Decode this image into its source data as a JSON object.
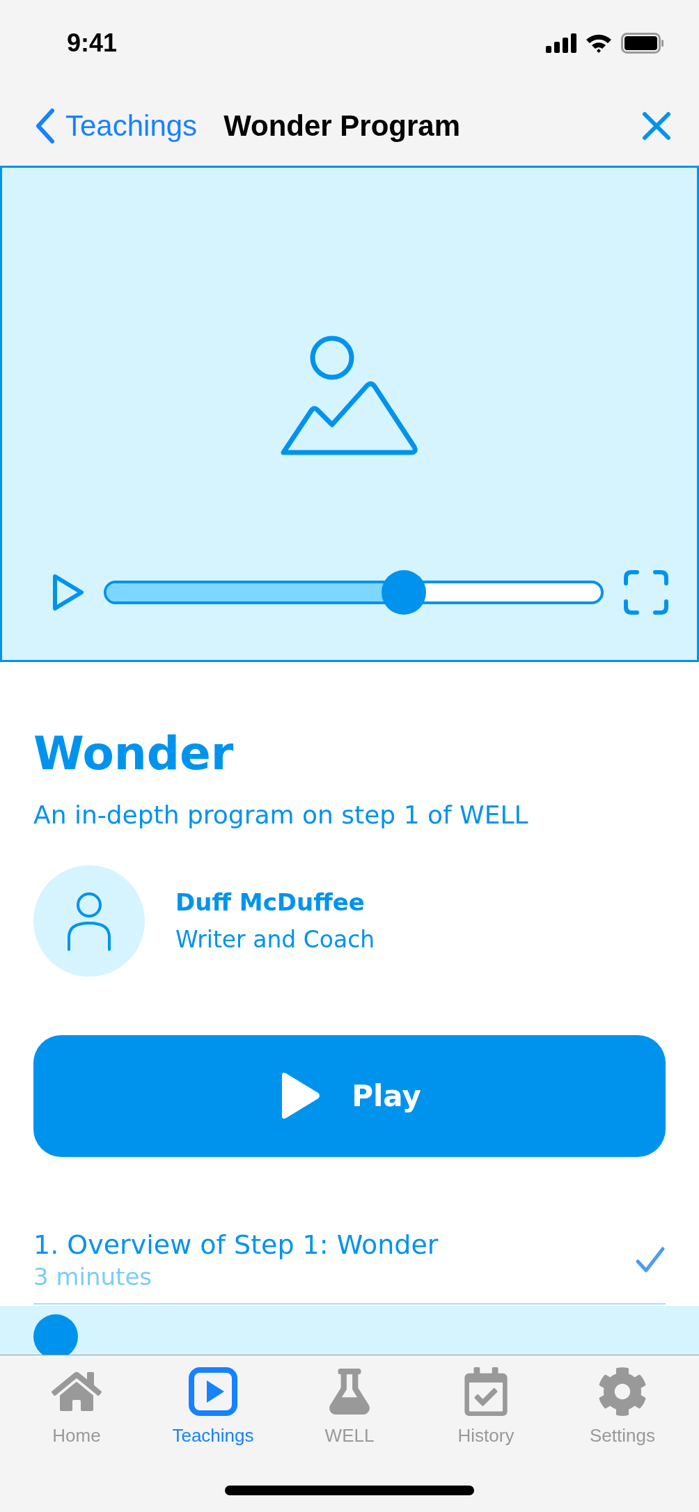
{
  "status_bar": {
    "time": "9:41"
  },
  "nav": {
    "back_label": "Teachings",
    "title": "Wonder Program"
  },
  "player": {
    "level": 0.6
  },
  "program": {
    "title": "Wonder",
    "subtitle": "An in-depth program on step 1 of WELL"
  },
  "author": {
    "name": "Duff McDuffee",
    "role": "Writer and Coach"
  },
  "play_button": {
    "label": "Play"
  },
  "lessons": [
    {
      "title": "1. Overview of Step 1: Wonder",
      "duration": "3 minutes",
      "completed": true
    }
  ],
  "tab_bar": [
    {
      "label": "Home",
      "selected": false
    },
    {
      "label": "Teachings",
      "selected": true
    },
    {
      "label": "WELL",
      "selected": false
    },
    {
      "label": "History",
      "selected": false
    },
    {
      "label": "Settings",
      "selected": false
    }
  ]
}
